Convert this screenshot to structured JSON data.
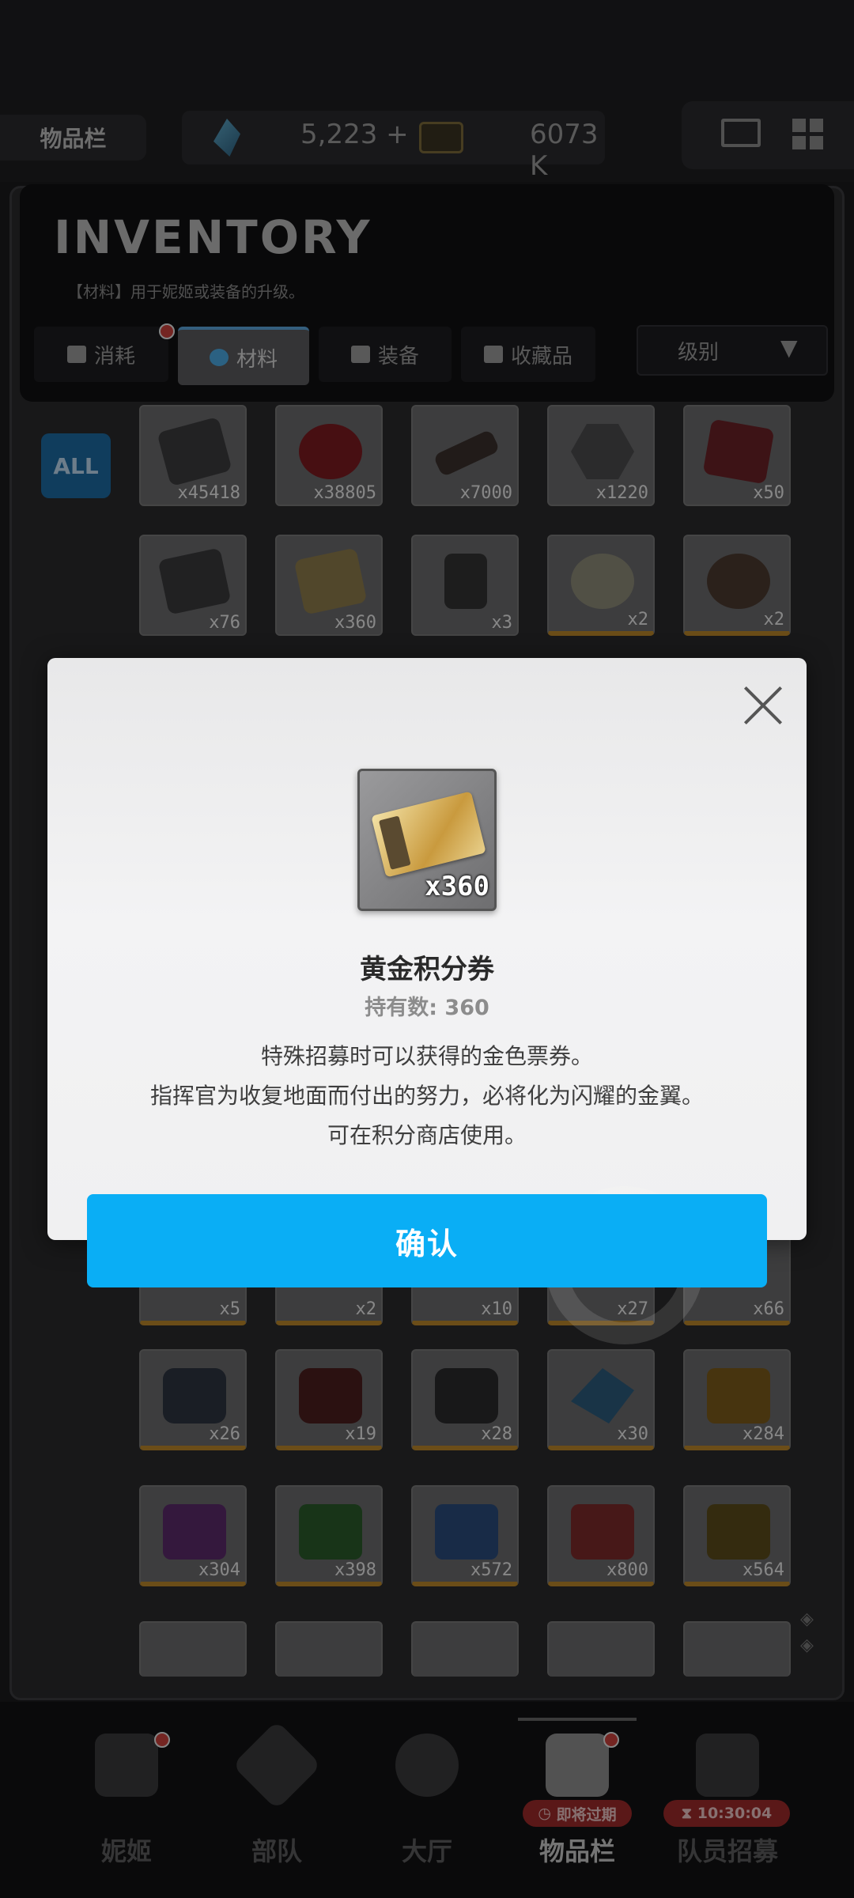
{
  "header": {
    "inventory_label": "物品栏",
    "gems": "5,223",
    "gems_plus": "+",
    "credits": "6073 K"
  },
  "inventory": {
    "title": "INVENTORY",
    "subtitle": "【材料】用于妮姬或装备的升级。",
    "tabs": [
      {
        "label": "消耗",
        "icon": "consumable-icon"
      },
      {
        "label": "材料",
        "icon": "material-icon"
      },
      {
        "label": "装备",
        "icon": "equipment-icon"
      },
      {
        "label": "收藏品",
        "icon": "collection-icon"
      }
    ],
    "sort_label": "级别",
    "all_label": "ALL",
    "row1": [
      "x45418",
      "x38805",
      "x7000",
      "x1220",
      "x50"
    ],
    "row2": [
      "x76",
      "x360",
      "x3",
      "x2",
      "x2"
    ],
    "row_hidden": [
      "x5",
      "x2",
      "x10",
      "x27",
      "x66"
    ],
    "row4": [
      "x26",
      "x19",
      "x28",
      "x30",
      "x284"
    ],
    "row5": [
      "x304",
      "x398",
      "x572",
      "x800",
      "x564"
    ]
  },
  "nav": [
    {
      "label": "妮姬",
      "icon": "nikke-icon"
    },
    {
      "label": "部队",
      "icon": "squad-icon"
    },
    {
      "label": "大厅",
      "icon": "lobby-icon"
    },
    {
      "label": "物品栏",
      "icon": "inventory-icon",
      "badge": "即将过期"
    },
    {
      "label": "队员招募",
      "icon": "recruit-icon",
      "badge": "10:30:04"
    }
  ],
  "modal": {
    "item_qty": "x360",
    "item_name": "黄金积分券",
    "held_label": "持有数: 360",
    "desc_line1": "特殊招募时可以获得的金色票券。",
    "desc_line2": "指挥官为收复地面而付出的努力，必将化为闪耀的金翼。",
    "desc_line3": "可在积分商店使用。",
    "confirm_label": "确认"
  },
  "colors": {
    "accent": "#0aaef5",
    "badge_red": "#9b2a2a"
  }
}
